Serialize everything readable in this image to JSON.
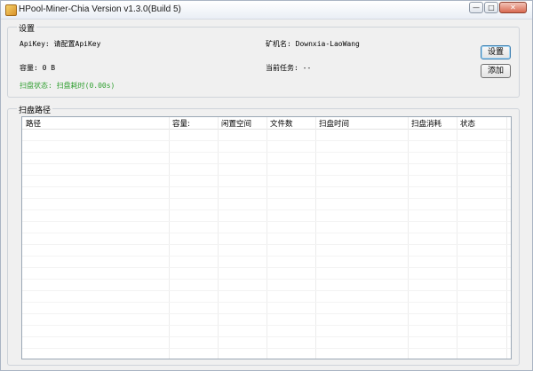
{
  "window": {
    "title": "HPool-Miner-Chia  Version v1.3.0(Build 5)",
    "controls": {
      "minimize": "—",
      "maximize": "□",
      "close": "✕"
    }
  },
  "settings": {
    "group_title": "设置",
    "apikey": "ApiKey: 请配置ApiKey",
    "miner_name": "矿机名: Downxia-LaoWang",
    "capacity": "容量: 0 B",
    "current_task": "当前任务: --",
    "scan_status": "扫盘状态: 扫盘耗时(0.00s)",
    "settings_button": "设置",
    "add_button": "添加"
  },
  "scan_paths": {
    "group_title": "扫盘路径",
    "columns": [
      "路径",
      "容量:",
      "闲置空间",
      "文件数",
      "扫盘时间",
      "扫盘消耗",
      "状态"
    ],
    "rows": []
  },
  "colors": {
    "status_green": "#2e9e2e",
    "window_bg": "#f0f0f0"
  }
}
